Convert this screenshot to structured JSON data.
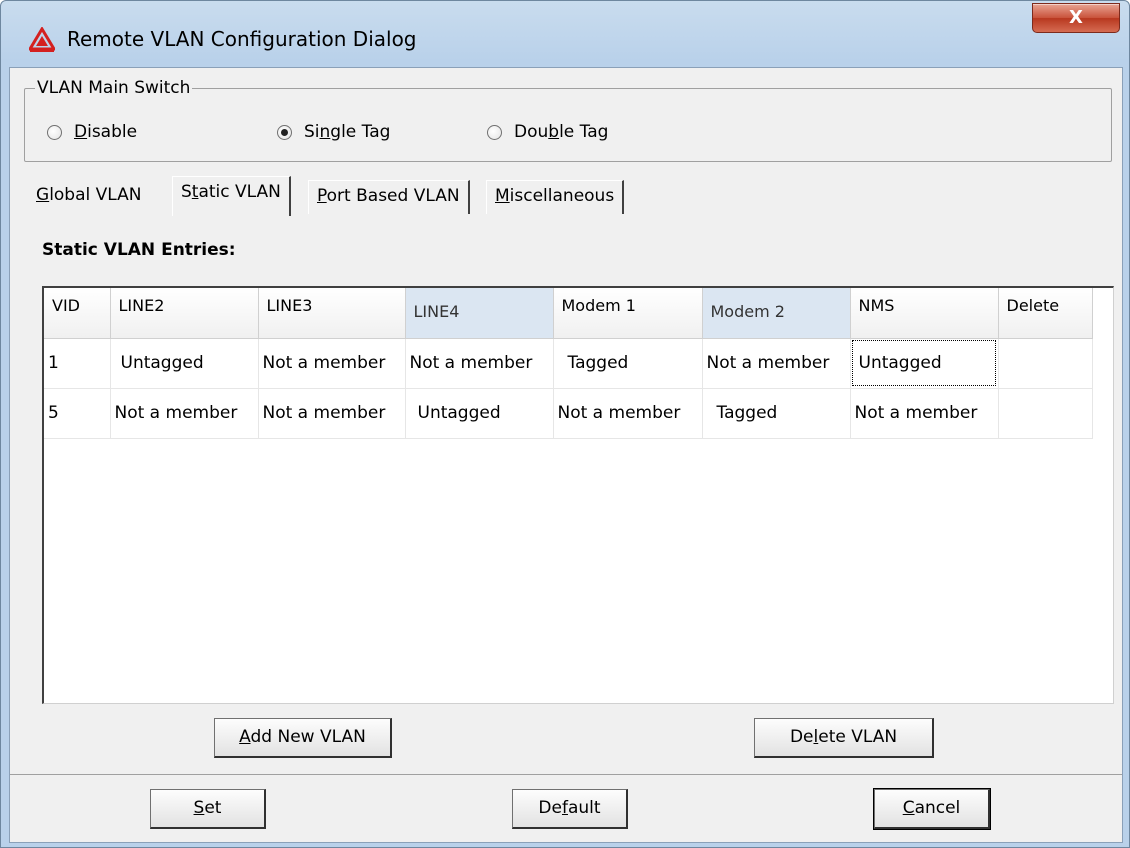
{
  "window": {
    "title": "Remote VLAN Configuration Dialog",
    "close_label": "X"
  },
  "main_switch": {
    "legend": "VLAN Main Switch",
    "options": [
      {
        "pre": "",
        "key": "D",
        "post": "isable",
        "checked": false
      },
      {
        "pre": "Si",
        "key": "n",
        "post": "gle Tag",
        "checked": true
      },
      {
        "pre": "Dou",
        "key": "b",
        "post": "le Tag",
        "checked": false
      }
    ]
  },
  "tabs": [
    {
      "pre": "",
      "key": "G",
      "post": "lobal VLAN",
      "active": false
    },
    {
      "pre": "S",
      "key": "t",
      "post": "atic VLAN",
      "active": true
    },
    {
      "pre": "",
      "key": "P",
      "post": "ort Based VLAN",
      "active": false
    },
    {
      "pre": "",
      "key": "M",
      "post": "iscellaneous",
      "active": false
    }
  ],
  "section_title": "Static VLAN Entries:",
  "table": {
    "columns": [
      "VID",
      "LINE2",
      "LINE3",
      "LINE4",
      "Modem 1",
      "Modem 2",
      "NMS",
      "Delete"
    ],
    "rows": [
      [
        "1",
        "Untagged",
        "Not a member",
        "Not a member",
        "Tagged",
        "Not a member",
        "Untagged",
        ""
      ],
      [
        "5",
        "Not a member",
        "Not a member",
        "Untagged",
        "Not a member",
        "Tagged",
        "Not a member",
        ""
      ]
    ]
  },
  "buttons": {
    "add": {
      "pre": "",
      "key": "A",
      "post": "dd New VLAN"
    },
    "delete": {
      "pre": "De",
      "key": "l",
      "post": "ete VLAN"
    },
    "set": {
      "pre": "",
      "key": "S",
      "post": "et"
    },
    "default": {
      "pre": "De",
      "key": "f",
      "post": "ault"
    },
    "cancel": {
      "pre": "",
      "key": "C",
      "post": "ancel"
    }
  }
}
